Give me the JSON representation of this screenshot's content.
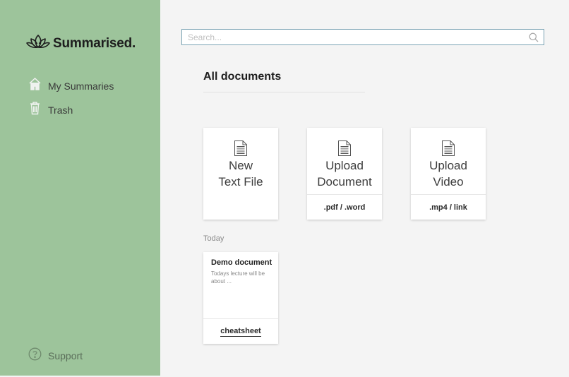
{
  "brand": {
    "name": "Summarised."
  },
  "sidebar": {
    "items": [
      {
        "label": "My Summaries",
        "icon": "home-icon"
      },
      {
        "label": "Trash",
        "icon": "trash-icon"
      }
    ],
    "support": {
      "label": "Support",
      "icon": "help-circle-icon"
    }
  },
  "search": {
    "placeholder": "Search...",
    "value": ""
  },
  "main": {
    "title": "All documents",
    "actions": [
      {
        "label": "New\nText File",
        "sub": ""
      },
      {
        "label": "Upload\nDocument",
        "sub": ".pdf / .word"
      },
      {
        "label": "Upload\nVideo",
        "sub": ".mp4 / link"
      }
    ],
    "sections": [
      {
        "label": "Today",
        "documents": [
          {
            "title": "Demo document",
            "preview": "Todays lecture will be about ...",
            "tag": "cheatsheet"
          }
        ]
      }
    ]
  },
  "colors": {
    "sidebar": "#9dc49b",
    "background": "#f4f4f4",
    "search_border": "#7aa3b3"
  }
}
